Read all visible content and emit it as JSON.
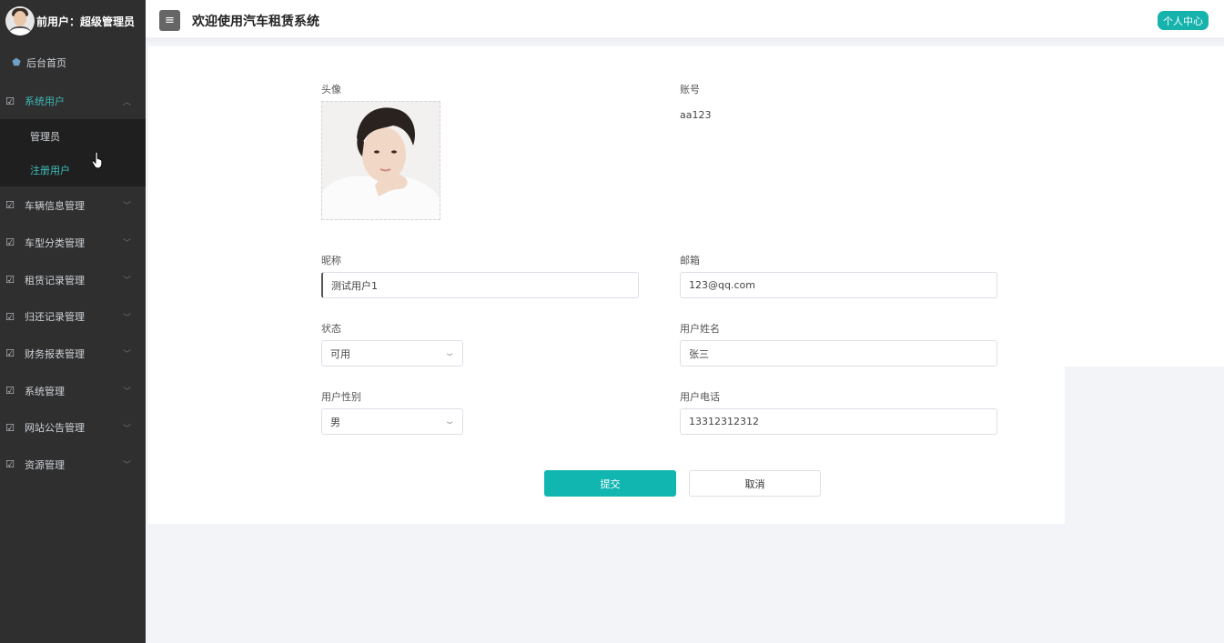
{
  "sidebar": {
    "user_label": "前用户：超级管理员",
    "menu": [
      {
        "label": "后台首页"
      },
      {
        "label": "系统用户"
      },
      {
        "label": "管理员"
      },
      {
        "label": "注册用户"
      },
      {
        "label": "车辆信息管理"
      },
      {
        "label": "车型分类管理"
      },
      {
        "label": "租赁记录管理"
      },
      {
        "label": "归还记录管理"
      },
      {
        "label": "财务报表管理"
      },
      {
        "label": "系统管理"
      },
      {
        "label": "网站公告管理"
      },
      {
        "label": "资源管理"
      }
    ]
  },
  "header": {
    "title": "欢迎使用汽车租赁系统",
    "profile_button": "个人中心",
    "menu_toggle_icon": "≡"
  },
  "form": {
    "avatar_label": "头像",
    "account_label": "账号",
    "account_value": "aa123",
    "nickname_label": "昵称",
    "nickname_value": "测试用户1",
    "email_label": "邮箱",
    "email_value": "123@qq.com",
    "status_label": "状态",
    "status_value": "可用",
    "realname_label": "用户姓名",
    "realname_value": "张三",
    "gender_label": "用户性别",
    "gender_value": "男",
    "phone_label": "用户电话",
    "phone_value": "13312312312",
    "submit_label": "提交",
    "cancel_label": "取消"
  },
  "colors": {
    "accent": "#11b6b1",
    "sidebar_bg": "#2f2f2f",
    "active_menu_text": "#3fc1bd"
  }
}
